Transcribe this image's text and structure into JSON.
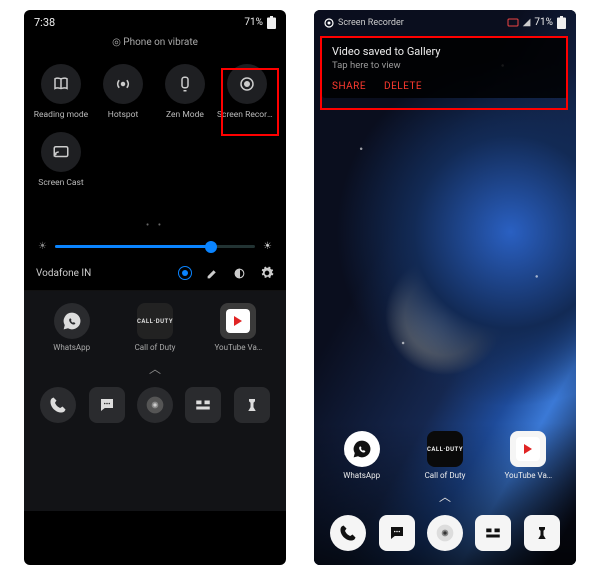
{
  "left": {
    "status": {
      "time": "7:38",
      "battery": "71%"
    },
    "vibrate_text": "Phone on vibrate",
    "tiles": [
      {
        "label": "Reading mode",
        "icon": "book-icon"
      },
      {
        "label": "Hotspot",
        "icon": "hotspot-icon"
      },
      {
        "label": "Zen Mode",
        "icon": "zen-icon"
      },
      {
        "label": "Screen Recorder",
        "icon": "record-icon",
        "highlighted": true
      },
      {
        "label": "Screen Cast",
        "icon": "cast-icon"
      }
    ],
    "carrier": "Vodafone IN",
    "apps_row": [
      {
        "label": "WhatsApp",
        "icon": "whatsapp-icon"
      },
      {
        "label": "Call of Duty",
        "icon": "cod-icon",
        "text": "CALL·DUTY"
      },
      {
        "label": "YouTube Va…",
        "icon": "youtube-icon"
      }
    ],
    "dock": [
      {
        "icon": "phone-icon"
      },
      {
        "icon": "messages-icon"
      },
      {
        "icon": "chrome-icon"
      },
      {
        "icon": "grid-icon"
      },
      {
        "icon": "pubg-icon"
      }
    ]
  },
  "right": {
    "status": {
      "recording": "Screen Recorder",
      "battery": "71%"
    },
    "toast": {
      "title": "Video saved to Gallery",
      "subtitle": "Tap here to view",
      "share": "SHARE",
      "delete": "DELETE"
    },
    "apps_row": [
      {
        "label": "WhatsApp",
        "icon": "whatsapp-icon"
      },
      {
        "label": "Call of Duty",
        "icon": "cod-icon",
        "text": "CALL·DUTY"
      },
      {
        "label": "YouTube Va…",
        "icon": "youtube-icon"
      }
    ],
    "dock": [
      {
        "icon": "phone-icon"
      },
      {
        "icon": "messages-icon"
      },
      {
        "icon": "chrome-icon"
      },
      {
        "icon": "grid-icon"
      },
      {
        "icon": "pubg-icon"
      }
    ]
  }
}
